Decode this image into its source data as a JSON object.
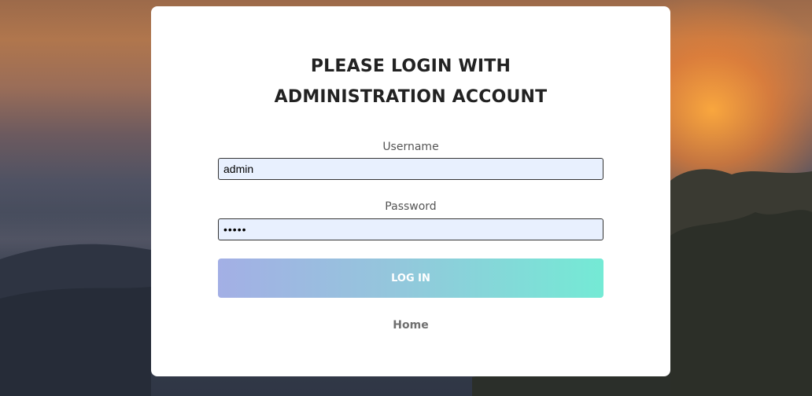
{
  "login": {
    "title_line1": "PLEASE LOGIN WITH",
    "title_line2": "ADMINISTRATION ACCOUNT",
    "username_label": "Username",
    "username_value": "admin",
    "password_label": "Password",
    "password_value": "•••••",
    "login_button": "LOG IN",
    "home_link": "Home"
  },
  "colors": {
    "button_gradient_start": "#a3afe5",
    "button_gradient_end": "#74ead5",
    "input_background": "#e8f0fe"
  }
}
